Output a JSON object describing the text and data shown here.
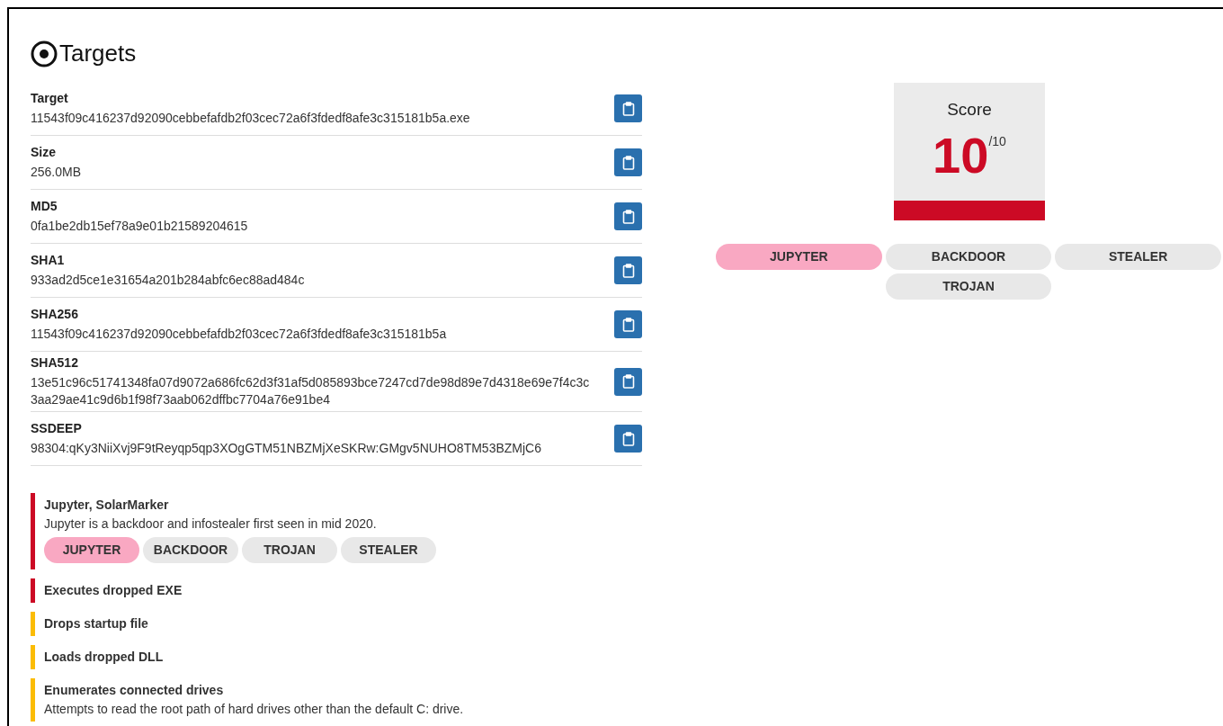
{
  "title": "Targets",
  "fields": [
    {
      "label": "Target",
      "value": "11543f09c416237d92090cebbefafdb2f03cec72a6f3fdedf8afe3c315181b5a.exe"
    },
    {
      "label": "Size",
      "value": "256.0MB"
    },
    {
      "label": "MD5",
      "value": "0fa1be2db15ef78a9e01b21589204615"
    },
    {
      "label": "SHA1",
      "value": "933ad2d5ce1e31654a201b284abfc6ec88ad484c"
    },
    {
      "label": "SHA256",
      "value": "11543f09c416237d92090cebbefafdb2f03cec72a6f3fdedf8afe3c315181b5a"
    },
    {
      "label": "SHA512",
      "value": "13e51c96c51741348fa07d9072a686fc62d3f31af5d085893bce7247cd7de98d89e7d4318e69e7f4c3c3aa29ae41c9d6b1f98f73aab062dffbc7704a76e91be4"
    },
    {
      "label": "SSDEEP",
      "value": "98304:qKy3NiiXvj9F9tReyqp5qp3XOgGTM51NBZMjXeSKRw:GMgv5NUHO8TM53BZMjC6"
    }
  ],
  "signatures": [
    {
      "title": "Jupyter, SolarMarker",
      "description": "Jupyter is a backdoor and infostealer first seen in mid 2020.",
      "color": "#cc0a25",
      "tags": [
        {
          "label": "JUPYTER",
          "kind": "family"
        },
        {
          "label": "BACKDOOR",
          "kind": "tag"
        },
        {
          "label": "TROJAN",
          "kind": "tag"
        },
        {
          "label": "STEALER",
          "kind": "tag"
        }
      ]
    },
    {
      "title": "Executes dropped EXE",
      "color": "#cc0a25"
    },
    {
      "title": "Drops startup file",
      "color": "#fbbc05"
    },
    {
      "title": "Loads dropped DLL",
      "color": "#fbbc05"
    },
    {
      "title": "Enumerates connected drives",
      "description": "Attempts to read the root path of hard drives other than the default C: drive.",
      "color": "#fbbc05"
    }
  ],
  "score": {
    "label": "Score",
    "value": "10",
    "max": "/10",
    "level": 1
  },
  "tags": [
    {
      "label": "JUPYTER",
      "kind": "family"
    },
    {
      "label": "BACKDOOR",
      "kind": "tag"
    },
    {
      "label": "STEALER",
      "kind": "tag"
    },
    {
      "label": "TROJAN",
      "kind": "tag"
    }
  ]
}
